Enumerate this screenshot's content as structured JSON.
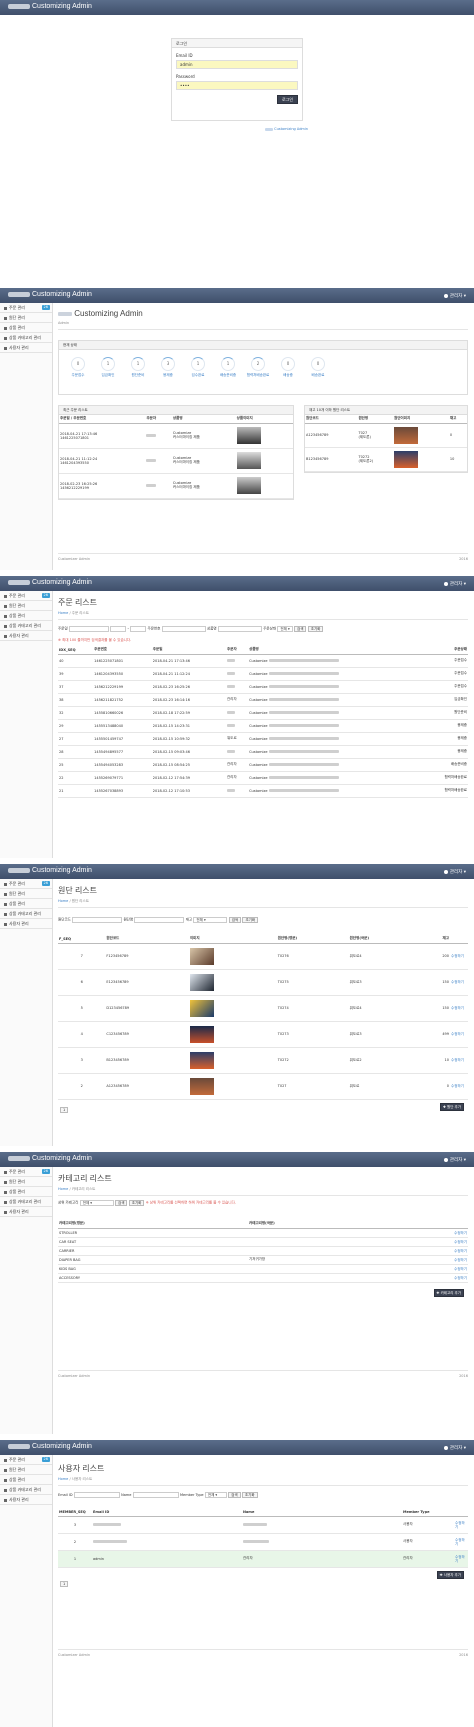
{
  "brand": "Customizing Admin",
  "user_label": "관리자",
  "footer": {
    "left": "Customizer Admin",
    "year": "2016"
  },
  "login": {
    "title": "로그인",
    "email_label": "Email ID",
    "email_value": "admin",
    "password_label": "Password",
    "password_value": "••••",
    "submit": "로그인",
    "link": "Customizing Admin"
  },
  "sidebar": {
    "order_mgmt": "주문 관리",
    "badge": "26",
    "fabric_mgmt": "원단 관리",
    "product_mgmt": "상품 관리",
    "category_mgmt": "상품 카테고리 관리",
    "user_mgmt": "사용자 관리"
  },
  "dashboard": {
    "title": "Customizing Admin",
    "crumb": "Admin",
    "status_title": "현재 상태",
    "statuses": [
      {
        "value": "0",
        "label": "주문접수"
      },
      {
        "value": "1",
        "label": "입금확인"
      },
      {
        "value": "1",
        "label": "원단준비"
      },
      {
        "value": "3",
        "label": "봉제중"
      },
      {
        "value": "1",
        "label": "검수완료"
      },
      {
        "value": "1",
        "label": "배송준비중"
      },
      {
        "value": "2",
        "label": "협력처배송완료"
      },
      {
        "value": "0",
        "label": "배송중"
      },
      {
        "value": "0",
        "label": "배송완료"
      }
    ],
    "recent_title": "최근 주문 리스트",
    "recent_headers": [
      "주문일 / 주문번호",
      "주문자",
      "상품명",
      "상품이미지"
    ],
    "recent_rows": [
      {
        "date": "2018-04-21 17:13:46",
        "no": "1461225071801",
        "product": "Customize",
        "opt": "커스터마이징 제품"
      },
      {
        "date": "2018-04-21 11:12:24",
        "no": "1461204393550",
        "product": "Customize",
        "opt": "커스터마이징 제품"
      },
      {
        "date": "2018-02-23 16:25:26",
        "no": "1456212229199",
        "product": "Customize",
        "opt": "커스터마이징 제품"
      }
    ],
    "stock_title": "재고 10개 이하 원단 리스트",
    "stock_headers": [
      "원단코드",
      "원단명",
      "원단이미지",
      "재고"
    ],
    "stock_rows": [
      {
        "code": "A123456789",
        "name": "T027",
        "sub": "(제도론)",
        "qty": "0"
      },
      {
        "code": "B123456789",
        "name": "T0272",
        "sub": "(제도론2)",
        "qty": "10"
      }
    ]
  },
  "orders": {
    "title": "주문 리스트",
    "crumb_home": "Home",
    "crumb": "주문 리스트",
    "filters": {
      "date": "주문일",
      "orderno": "주문번호",
      "product": "상품명",
      "status": "주문상태",
      "status_value": "전체",
      "search": "검색",
      "reset": "초기화"
    },
    "notice": "※ 최대 100 줄까지만 검색결과를 볼 수 있습니다.",
    "headers": [
      "IDX_SEQ",
      "주문번호",
      "주문일",
      "주문자",
      "상품명",
      "주문상태"
    ],
    "rows": [
      {
        "idx": "40",
        "no": "1461225071801",
        "date": "2018-04-21 17:13:46",
        "who": "",
        "product": "Customize",
        "status": "주문접수"
      },
      {
        "idx": "39",
        "no": "1461204393550",
        "date": "2018-04-21 11:12:24",
        "who": "",
        "product": "Customize",
        "status": "주문접수"
      },
      {
        "idx": "37",
        "no": "1456212229199",
        "date": "2018-02-23 16:25:26",
        "who": "",
        "product": "Customize",
        "status": "주문접수"
      },
      {
        "idx": "38",
        "no": "1456211821752",
        "date": "2018-02-23 16:14:16",
        "who": "관리자",
        "product": "Customize",
        "status": "입금확인"
      },
      {
        "idx": "32",
        "no": "1455810660026",
        "date": "2018-02-18 17:22:59",
        "who": "",
        "product": "Customize",
        "status": "원단준비"
      },
      {
        "idx": "29",
        "no": "1455513488040",
        "date": "2018-02-15 14:23:31",
        "who": "",
        "product": "Customize",
        "status": "봉제중"
      },
      {
        "idx": "27",
        "no": "1455501459747",
        "date": "2018-02-15 10:59:32",
        "who": "워도르",
        "product": "Customize",
        "status": "봉제중"
      },
      {
        "idx": "28",
        "no": "1455494895577",
        "date": "2018-02-15 09:03:46",
        "who": "",
        "product": "Customize",
        "status": "봉제중"
      },
      {
        "idx": "25",
        "no": "1455494053283",
        "date": "2018-02-15 08:54:25",
        "who": "관리자",
        "product": "Customize",
        "status": "배송준비중"
      },
      {
        "idx": "22",
        "no": "1455269079771",
        "date": "2018-02-12 17:54:39",
        "who": "관리자",
        "product": "Customize",
        "status": "협력처배송완료"
      },
      {
        "idx": "21",
        "no": "1455267038893",
        "date": "2018-02-12 17:10:53",
        "who": "",
        "product": "Customize",
        "status": "협력처배송완료"
      }
    ]
  },
  "fabrics": {
    "title": "원단 리스트",
    "crumb_home": "Home",
    "crumb": "원단 리스트",
    "filters": {
      "code": "원단코드",
      "name": "원단명",
      "stock": "재고",
      "stock_value": "전체",
      "search": "검색",
      "reset": "초기화"
    },
    "headers": [
      "F_SEQ",
      "원단코드",
      "이미지",
      "원단명(영문)",
      "원단명(국문)",
      "재고"
    ],
    "rows": [
      {
        "seq": "7",
        "code": "F123456789",
        "name": "T0276",
        "kname": "워도르4",
        "qty": "200"
      },
      {
        "seq": "6",
        "code": "E123456789",
        "name": "T0275",
        "kname": "워도르3",
        "qty": "150"
      },
      {
        "seq": "5",
        "code": "D123456789",
        "name": "T0274",
        "kname": "워도르4",
        "qty": "150"
      },
      {
        "seq": "4",
        "code": "C123456789",
        "name": "T0273",
        "kname": "워도르3",
        "qty": "499"
      },
      {
        "seq": "3",
        "code": "B123456789",
        "name": "T0272",
        "kname": "워도르2",
        "qty": "10"
      },
      {
        "seq": "2",
        "code": "A123456789",
        "name": "T027",
        "kname": "워도르",
        "qty": "0"
      }
    ],
    "edit": "수정하기",
    "page": "1",
    "add": "원단 추가"
  },
  "categories": {
    "title": "카테고리 리스트",
    "crumb_home": "Home",
    "crumb": "카테고리 리스트",
    "filter_label": "상위 카테고리",
    "filter_value": "전체",
    "search": "검색",
    "reset": "초기화",
    "notice": "※ 상위 카테고리를 선택하면 하위 카테고리를 볼 수 있습니다.",
    "headers": [
      "카테고리명(영문)",
      "카테고리명(국문)"
    ],
    "rows": [
      {
        "en": "STROLLER",
        "ko": ""
      },
      {
        "en": "CAR SEAT",
        "ko": ""
      },
      {
        "en": "CARRIER",
        "ko": ""
      },
      {
        "en": "DIAPER BAG",
        "ko": "기저귀가방"
      },
      {
        "en": "KIDS BAG",
        "ko": ""
      },
      {
        "en": "ACCESSORY",
        "ko": ""
      }
    ],
    "edit": "수정하기",
    "add": "카테고리 추가"
  },
  "users": {
    "title": "사용자 리스트",
    "crumb_home": "Home",
    "crumb": "사용자 리스트",
    "filters": {
      "email": "Email ID",
      "name": "Name",
      "type": "Member Type",
      "type_value": "전체",
      "search": "검색",
      "reset": "초기화"
    },
    "headers": [
      "MEMBER_SEQ",
      "Email ID",
      "Name",
      "Member Type"
    ],
    "rows": [
      {
        "seq": "3",
        "email": "",
        "name": "",
        "type": "사용자"
      },
      {
        "seq": "2",
        "email": "",
        "name": "",
        "type": "사용자"
      },
      {
        "seq": "1",
        "email": "admin",
        "name": "관리자",
        "type": "관리자"
      }
    ],
    "edit": "수정하기",
    "page": "1",
    "add": "사용자 추가"
  }
}
